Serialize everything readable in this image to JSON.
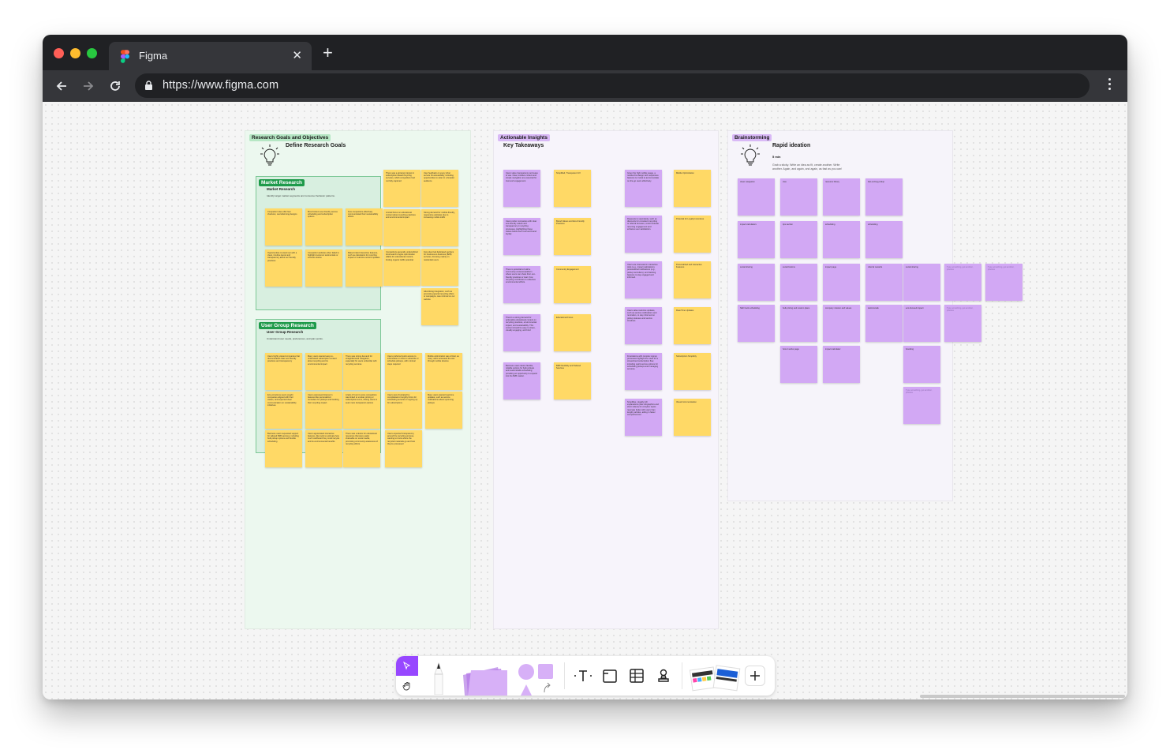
{
  "browser": {
    "tab_title": "Figma",
    "url": "https://www.figma.com"
  },
  "research": {
    "section_label": "Research Goals and Objectives",
    "heading": "Define Research Goals",
    "market": {
      "badge": "Market Research",
      "title": "Market Research",
      "desc": "Identify target market segments and consumer behavior patterns."
    },
    "user_group": {
      "badge": "User Group Research",
      "title": "User Group Research",
      "desc": "Understand user needs, preferences, and pain points."
    },
    "market_notes": [
      "Competitor sites offer fast checkout, overwhelming designs",
      "Most brokers use friendly service scheduling and subscription options",
      "Few competitors effectively communicated their sustainability efforts",
      "Opportunities to stand out with a clean, intuitive layout and transparency about our friendly practices",
      "Competitor websites often failed to highlight customer testimonials or success stories",
      "Make limited interactive features, such as calculators for recycling impact or real-time service updates"
    ],
    "market_side_notes": [
      "There was a growing interest in subscription-based recycling services, which competitors had not fully captured",
      "User feedback on every other service hit accessibility, including opportunities to cater to a broader audience",
      "Limited focus on educational content about recycling practices and environmental impact",
      "Strong demand for mobile-friendly, responsive websites due to increasing mobile traffic",
      "Competitors generally underutilized local search engine optimization (SEO) for educational content, limiting organic traffic potential",
      "Few sites had dedicated sections for business-to-business (B2B) services, focusing mainly on residential users",
      "Advertising integration, such as promoting special recycling offers or campaigns, was minimal on our website"
    ],
    "user_notes": [
      "Users highly valued companies that demonstrated clear eco-friendly practices and transparency",
      "Many users wanted easy-to-understand subscription content about recycling and its environmental impact",
      "There was strong demand for straightforward navigation, especially for users unfamiliar with recycling services",
      "Users preferred quick access to information on how to subscribe or schedule pickups, with minimal steps required",
      "Mobile optimization was critical, as many users accessed the site through mobile devices",
      "Eco-conscious users sought companies aligned with their values, and expected clear communication on sustainability initiatives",
      "Users expressed interest in features like personalized reminders for pickups and tracking their recycling impact",
      "A lack of trust in some competitors was linked to unclear pricing or subscription terms, driving users to seek more transparent options",
      "Users were frustrated by complicated or lengthy forms for scheduling services or signing up for subscriptions",
      "Many users wanted real-time updates, such as service notifications about upcoming pickups",
      "Business users requested support for tailored B2B services, including bulk pickup options and flexible scheduling",
      "Users appreciated interactive features, like tools to estimate how much cardboard they could recycle and its environmental benefits",
      "There was a desire for educational resources that were easily shareable on social media, promoting community awareness of recycling efforts",
      "Users expected transparency around the recycling process, wanting to know where the recycled materials go and how they're processed"
    ],
    "user_extra_notes": []
  },
  "insights": {
    "section_label": "Actionable Insights",
    "heading": "Key Takeaways",
    "purple_col1": [
      "Users value transparency and ease of use. Clear, intuitive content and simple navigation are essential for trust and engagement.",
      "Users prefer companies with clear eco-friendly values and transparency in recycling processes. Highlighting these values builds user trust and brand loyalty.",
      "There is potential to build a community-centered platform where users can share their eco-friendly practices or learn how recycling contributes to collective environmental efforts.",
      "There's a strong demand for actionable educational content on recycling practices, environmental impact, and sustainability. This content should be easy to share, visually engaging, and brief.",
      "Business users desire flexible, reliable options for bulk pickups and customizable scheduling, providing an opportunity to expand into the B2B market."
    ],
    "yellow_col1": [
      "Simplified, Transparent UX",
      "Brand Values and Eco-Friendly Practices",
      "Community Engagement",
      "Educational Focus",
      "B2B Flexibility and Tailored Services"
    ],
    "purple_col2": [
      "Given the high mobile usage, a mobile-first design with responsive features is crucial to accommodate on-the-go users effectively.",
      "Requests to seamlessly, such as discounts for consistent recycling or referral bonuses, could motivate recurring engagement and enhance user satisfaction.",
      "Users are interested in interactive tools (e.g., impact calculators), personalized notifications (e.g., pickup reminders), and tracking features to stay engaged and informed.",
      "Users value real-time updates, such as service notifications and reminders, to stay informed on pickup statuses and service timelines.",
      "Frustrations with complex signup processes highlight the need for a streamlined subscription flow, including quick service options for scheduling pickups and managing services.",
      "Simplifies, visually rich explanations (like infographics and short videos) for complex topics resonate better with users than lengthy articles, aiding in faster comprehension."
    ],
    "yellow_col2": [
      "Mobile Optimization",
      "Potential for Loyalty Incentives",
      "Personalized and Interactive Features",
      "Real-Time Updates",
      "Subscription Simplicity",
      "Visual Communication"
    ]
  },
  "brainstorm": {
    "section_label": "Brainstorming",
    "heading": "Rapid ideation",
    "time": "5 min",
    "desc": "Grab a sticky. Write an idea as fit, create another. Write another. Again, and again, and again, as fast as you can!",
    "notes": [
      "clean navigation",
      "ctas",
      "resource library",
      "fast-sorting pickup",
      "impact calculators",
      "tips section",
      "scheduling",
      "scheduling",
      "social sharing",
      "social buttons",
      "impact page",
      "referral rewards",
      "social sharing",
      "SEO tools scheduling",
      "bulk pricing and custom plans",
      "company mission and values",
      "testimonials",
      "eco-focused impact",
      "how it works page",
      "impact calculator",
      "branding"
    ],
    "ghost_text": "Type something, get another, practice"
  },
  "colors": {
    "accent": "#9747ff",
    "sticky_yellow": "#ffd966",
    "sticky_purple": "#d2a8f4",
    "group_green": "#1e9a4a"
  },
  "icons": [
    "figma-logo-icon",
    "back-icon",
    "forward-icon",
    "reload-icon",
    "lock-icon",
    "menu-icon",
    "cursor-icon",
    "hand-icon",
    "pen-icon",
    "sticky-icon",
    "shape-icon",
    "text-icon",
    "section-icon",
    "table-icon",
    "stamp-icon",
    "templates-icon",
    "plus-icon"
  ]
}
